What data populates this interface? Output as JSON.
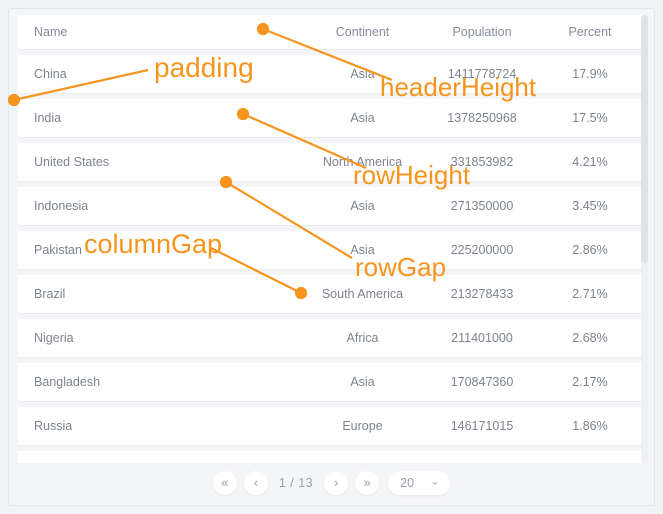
{
  "grid": {
    "columns": [
      {
        "key": "name",
        "label": "Name",
        "align": "left"
      },
      {
        "key": "continent",
        "label": "Continent",
        "align": "center"
      },
      {
        "key": "population",
        "label": "Population",
        "align": "center"
      },
      {
        "key": "percent",
        "label": "Percent",
        "align": "center"
      }
    ],
    "rows": [
      {
        "name": "China",
        "continent": "Asia",
        "population": "1411778724",
        "percent": "17.9%"
      },
      {
        "name": "India",
        "continent": "Asia",
        "population": "1378250968",
        "percent": "17.5%"
      },
      {
        "name": "United States",
        "continent": "North America",
        "population": "331853982",
        "percent": "4.21%"
      },
      {
        "name": "Indonesia",
        "continent": "Asia",
        "population": "271350000",
        "percent": "3.45%"
      },
      {
        "name": "Pakistan",
        "continent": "Asia",
        "population": "225200000",
        "percent": "2.86%"
      },
      {
        "name": "Brazil",
        "continent": "South America",
        "population": "213278433",
        "percent": "2.71%"
      },
      {
        "name": "Nigeria",
        "continent": "Africa",
        "population": "211401000",
        "percent": "2.68%"
      },
      {
        "name": "Bangladesh",
        "continent": "Asia",
        "population": "170847360",
        "percent": "2.17%"
      },
      {
        "name": "Russia",
        "continent": "Europe",
        "population": "146171015",
        "percent": "1.86%"
      },
      {
        "name": "",
        "continent": "",
        "population": "",
        "percent": ""
      }
    ]
  },
  "pagination": {
    "first_label": "«",
    "prev_label": "‹",
    "page_indicator": "1 / 13",
    "next_label": "›",
    "last_label": "»",
    "page_size": "20",
    "caret_label": "⌄"
  },
  "annotations": {
    "padding": "padding",
    "header_height": "headerHeight",
    "row_height": "rowHeight",
    "column_gap": "columnGap",
    "row_gap": "rowGap",
    "color": "#F7941E"
  }
}
